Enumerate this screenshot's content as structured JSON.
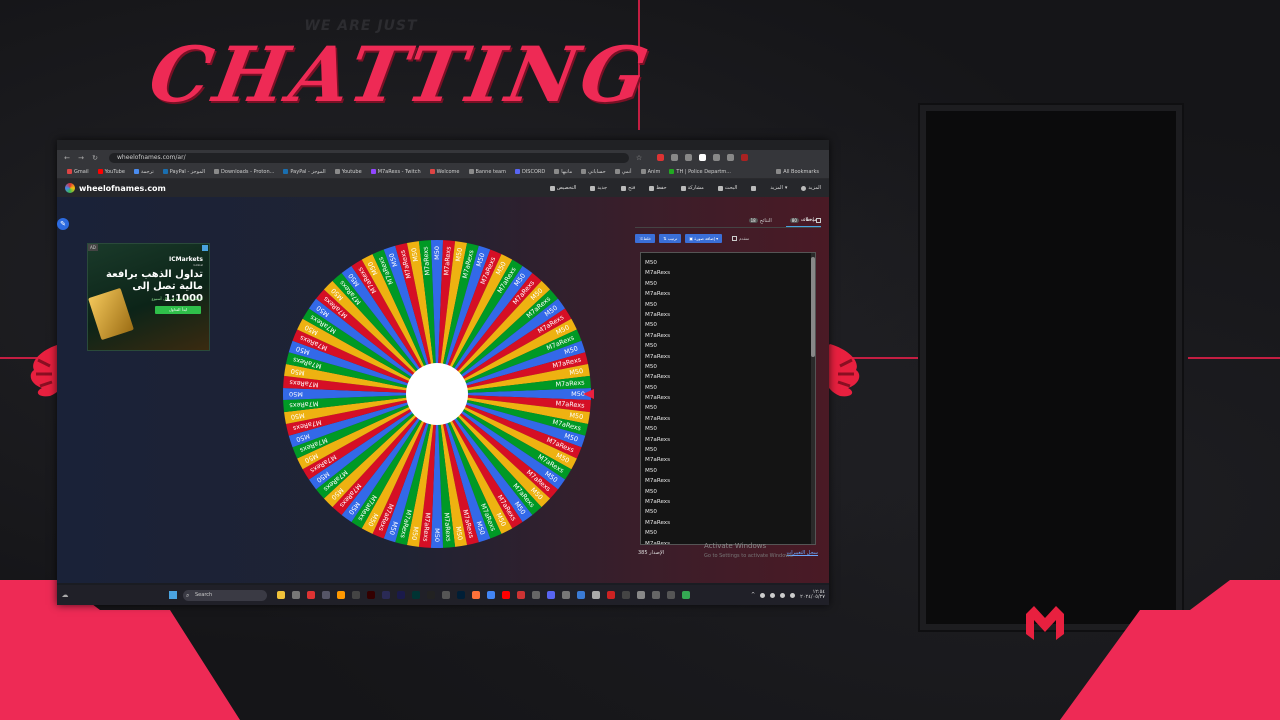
{
  "overlay": {
    "small_text": "WE ARE JUST",
    "title": "CHATTING",
    "accent_color": "#ee2a55"
  },
  "browser": {
    "url": "wheelofnames.com/ar/",
    "bookmarks": [
      "Gmail",
      "YouTube",
      "ترجمة",
      "PayPal - الموجز",
      "Downloads - Proton...",
      "PayPal - الموجز",
      "Youtube",
      "M7aRexs - Twitch",
      "Welcome",
      "Banne team",
      "DISCORD",
      "ماتيها",
      "حساباتي",
      "أنمي",
      "Anim",
      "TH | Police Departm..."
    ],
    "all_bookmarks": "All Bookmarks"
  },
  "site": {
    "name": "wheelofnames.com",
    "menu": [
      "المزيد",
      "المزيد",
      "ملء الشاشة",
      "البحث",
      "مشاركة",
      "حفظ",
      "فتح",
      "جديد",
      "التخصيص"
    ]
  },
  "ad": {
    "badge": "AD",
    "brand": "ICMarkets",
    "brand_sub": "Global",
    "headline": "تداول الذهب برافعة مالية تصل إلى 1:1000",
    "body": "احصل على ميزة في كل أسبوع",
    "cta": "ابدأ التداول"
  },
  "wheel": {
    "entries_pattern": [
      "M50",
      "M7aRexs"
    ],
    "segment_count": 80,
    "colors": [
      "#3369e8",
      "#d50f25",
      "#eeb211",
      "#009925"
    ],
    "pointer_color": "#e8203f"
  },
  "panel": {
    "tab_entries": "مدخلات",
    "tab_entries_count": "80",
    "tab_results": "النتائج",
    "tab_results_count": "18",
    "hide": "إخفاء",
    "btn_shuffle": "خلط",
    "btn_sort": "ترتيب",
    "btn_add_image": "إضافة صورة",
    "advanced": "متقدم",
    "entries": [
      "M50",
      "M7aRexs",
      "M50",
      "M7aRexs",
      "M50",
      "M7aRexs",
      "M50",
      "M7aRexs",
      "M50",
      "M7aRexs",
      "M50",
      "M7aRexs",
      "M50",
      "M7aRexs",
      "M50",
      "M7aRexs",
      "M50",
      "M7aRexs",
      "M50",
      "M7aRexs",
      "M50",
      "M7aRexs",
      "M50",
      "M7aRexs",
      "M50",
      "M7aRexs",
      "M50",
      "M7aRexs"
    ],
    "version": "385 الإصدار",
    "history": "سجل التغييرات"
  },
  "windows": {
    "activate": "Activate Windows",
    "activate_sub": "Go to Settings to activate Windows.",
    "search_placeholder": "Search",
    "clock_time": "١٢:٥٤",
    "clock_date": "٢٠٢٤/٠٥/٢٧"
  }
}
